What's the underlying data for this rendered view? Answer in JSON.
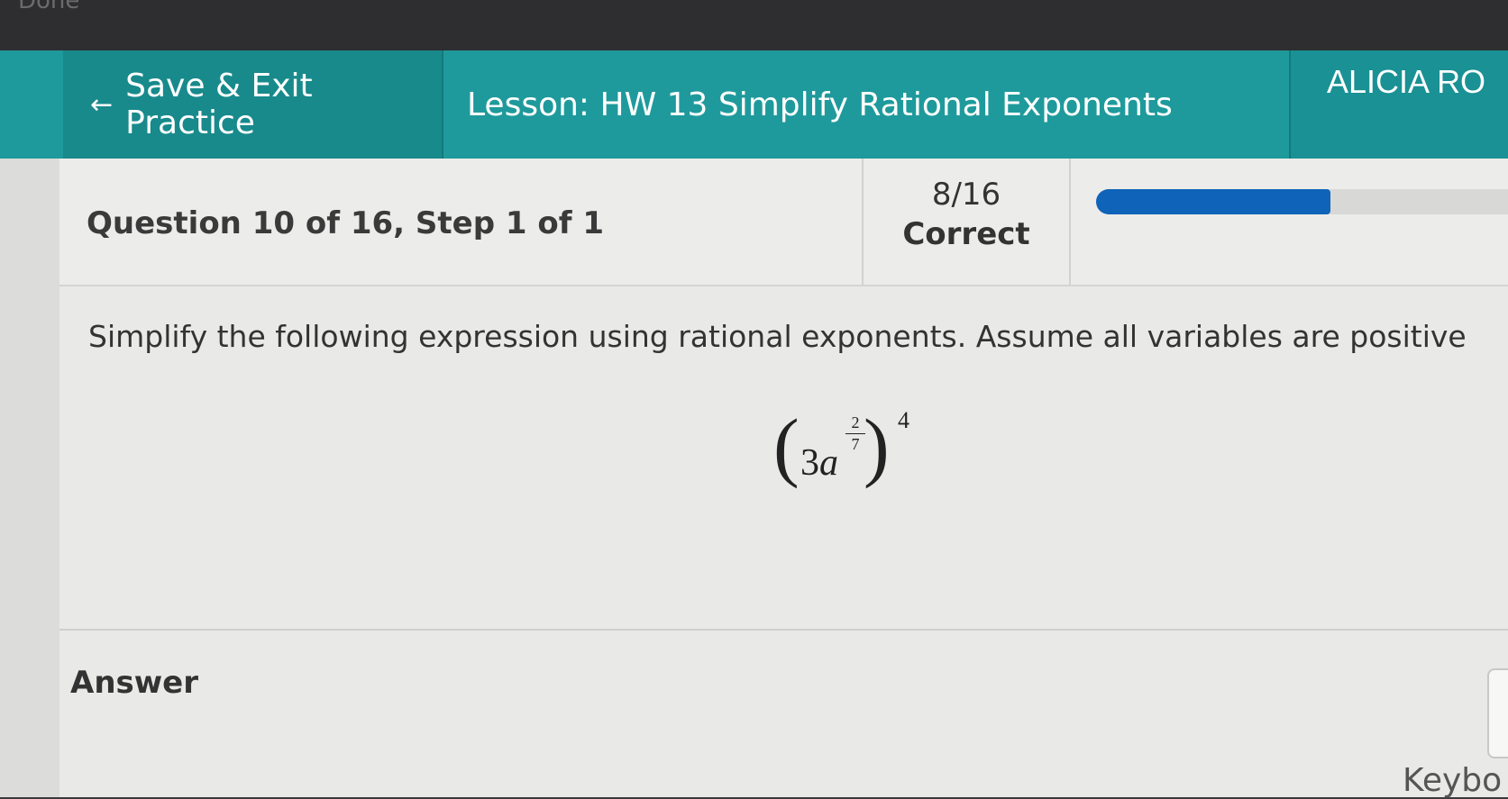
{
  "bezel": {
    "text": "Done"
  },
  "header": {
    "save_exit_label": "Save & Exit Practice",
    "lesson_title": "Lesson: HW 13 Simplify Rational Exponents",
    "user_name": "ALICIA RO"
  },
  "question": {
    "label": "Question 10 of 16,  Step 1 of 1",
    "score_fraction": "8/16",
    "score_word": "Correct",
    "progress": 0.5,
    "prompt": "Simplify the following expression using rational exponents. Assume all variables are positive",
    "expression": {
      "coefficient": "3",
      "variable": "a",
      "inner_exponent_numerator": "2",
      "inner_exponent_denominator": "7",
      "outer_exponent": "4"
    }
  },
  "answer": {
    "label": "Answer",
    "keyboard_label": "Keybo"
  },
  "colors": {
    "header_teal": "#1f9a9c",
    "progress_blue": "#0f63b8",
    "content_bg": "#e9e9e7"
  }
}
